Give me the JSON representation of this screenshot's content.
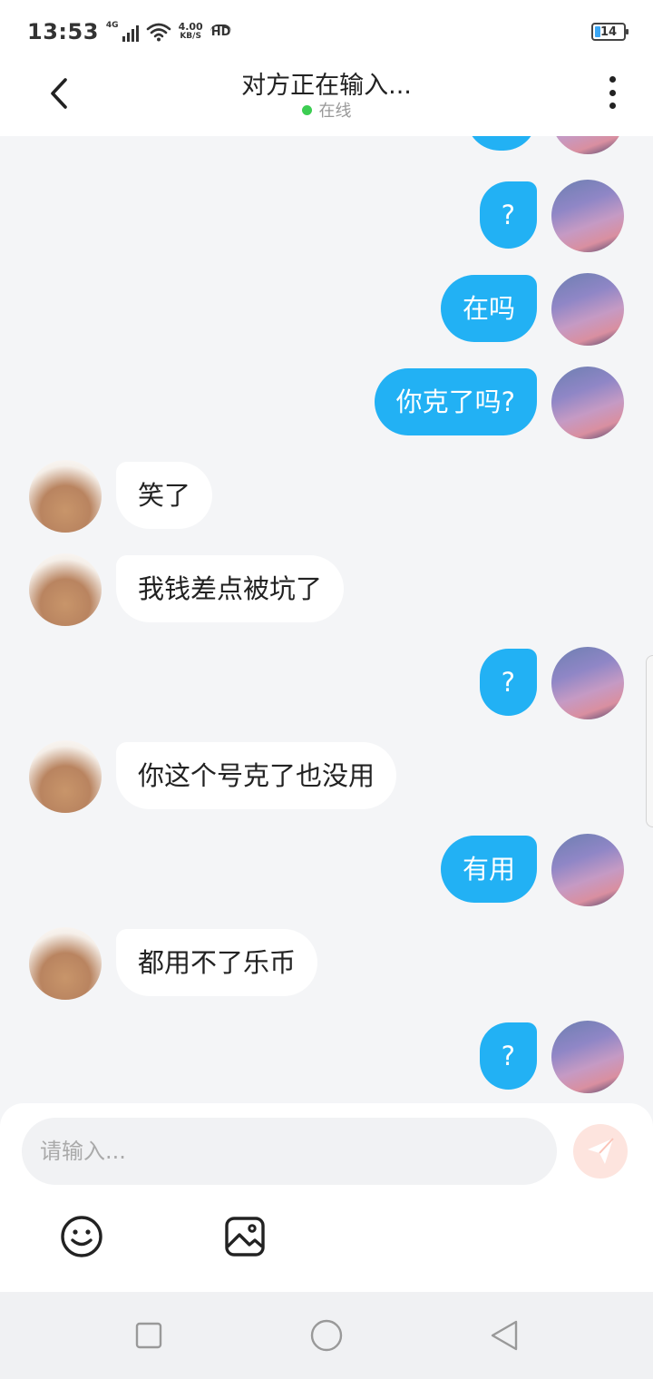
{
  "status_bar": {
    "time": "13:53",
    "network": "4G",
    "speed_value": "4.00",
    "speed_unit": "KB/S",
    "hd": "HD",
    "battery": "14",
    "battery_color": "#3ca7f5"
  },
  "header": {
    "title": "对方正在输入...",
    "status": "在线",
    "status_color": "#3ccd52"
  },
  "colors": {
    "outgoing_bubble": "#22b1f4",
    "incoming_bubble": "#ffffff",
    "background": "#f4f5f7"
  },
  "messages": [
    {
      "side": "out",
      "text": "?"
    },
    {
      "side": "out",
      "text": "在吗"
    },
    {
      "side": "out",
      "text": "你克了吗?"
    },
    {
      "side": "in",
      "text": "笑了"
    },
    {
      "side": "in",
      "text": "我钱差点被坑了"
    },
    {
      "side": "out",
      "text": "?"
    },
    {
      "side": "in",
      "text": "你这个号克了也没用"
    },
    {
      "side": "out",
      "text": "有用"
    },
    {
      "side": "in",
      "text": "都用不了乐币"
    },
    {
      "side": "out",
      "text": "?"
    }
  ],
  "input": {
    "placeholder": "请输入..."
  },
  "icons": {
    "back": "chevron-left-icon",
    "more": "more-vertical-icon",
    "send": "paper-plane-icon",
    "emoji": "smiley-icon",
    "image": "image-icon",
    "nav_recent": "square-icon",
    "nav_home": "circle-icon",
    "nav_back": "triangle-back-icon"
  }
}
